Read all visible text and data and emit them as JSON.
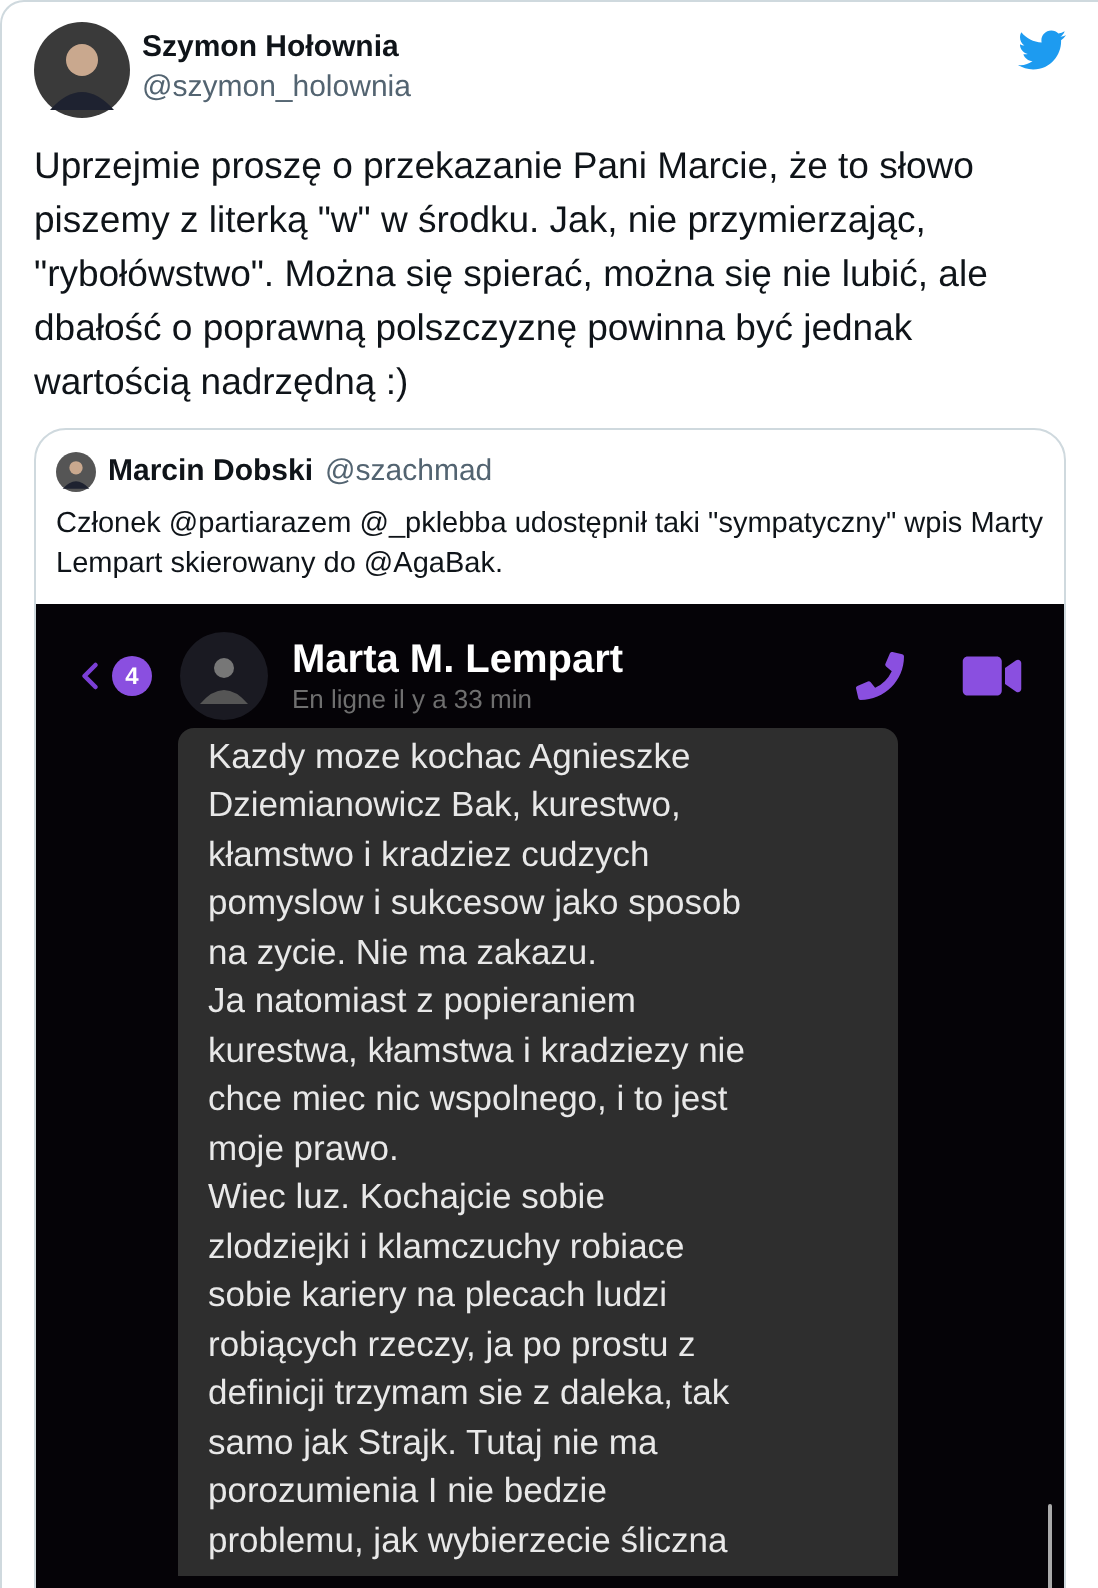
{
  "tweet": {
    "author": {
      "name": "Szymon Hołownia",
      "handle": "@szymon_holownia"
    },
    "text": "Uprzejmie proszę o przekazanie Pani Marcie, że to słowo piszemy z literką \"w\" w środku. Jak, nie przymierzając, \"rybołówstwo\". Można się spierać, można się nie lubić, ale dbałość o poprawną polszczyznę powinna być jednak wartością nadrzędną :)",
    "quote": {
      "author": {
        "name": "Marcin Dobski",
        "handle": "@szachmad"
      },
      "text": "Członek @partiarazem @_pklebba udostępnił taki \"sympatyczny\" wpis Marty Lempart skierowany do @AgaBak.",
      "chat": {
        "unread_badge": "4",
        "contact_name": "Marta M. Lempart",
        "status": "En ligne il y a 33 min",
        "message_lines": [
          "Kazdy moze kochac Agnieszke",
          "Dziemianowicz Bak, kurestwo,",
          "kłamstwo i kradziez cudzych",
          "pomyslow i sukcesow jako sposob",
          "na zycie. Nie ma zakazu.",
          "Ja natomiast z popieraniem",
          "kurestwa, kłamstwa i kradziezy nie",
          "chce miec nic wspolnego, i to jest",
          "moje prawo.",
          "Wiec luz. Kochajcie sobie",
          "zlodziejki i klamczuchy robiace",
          "sobie kariery na plecach ludzi",
          "robiących rzeczy, ja po prostu z",
          "definicji trzymam sie z daleka, tak",
          "samo jak Strajk. Tutaj nie ma",
          "porozumienia I nie bedzie",
          "problemu, jak wybierzecie śliczna"
        ]
      }
    }
  }
}
